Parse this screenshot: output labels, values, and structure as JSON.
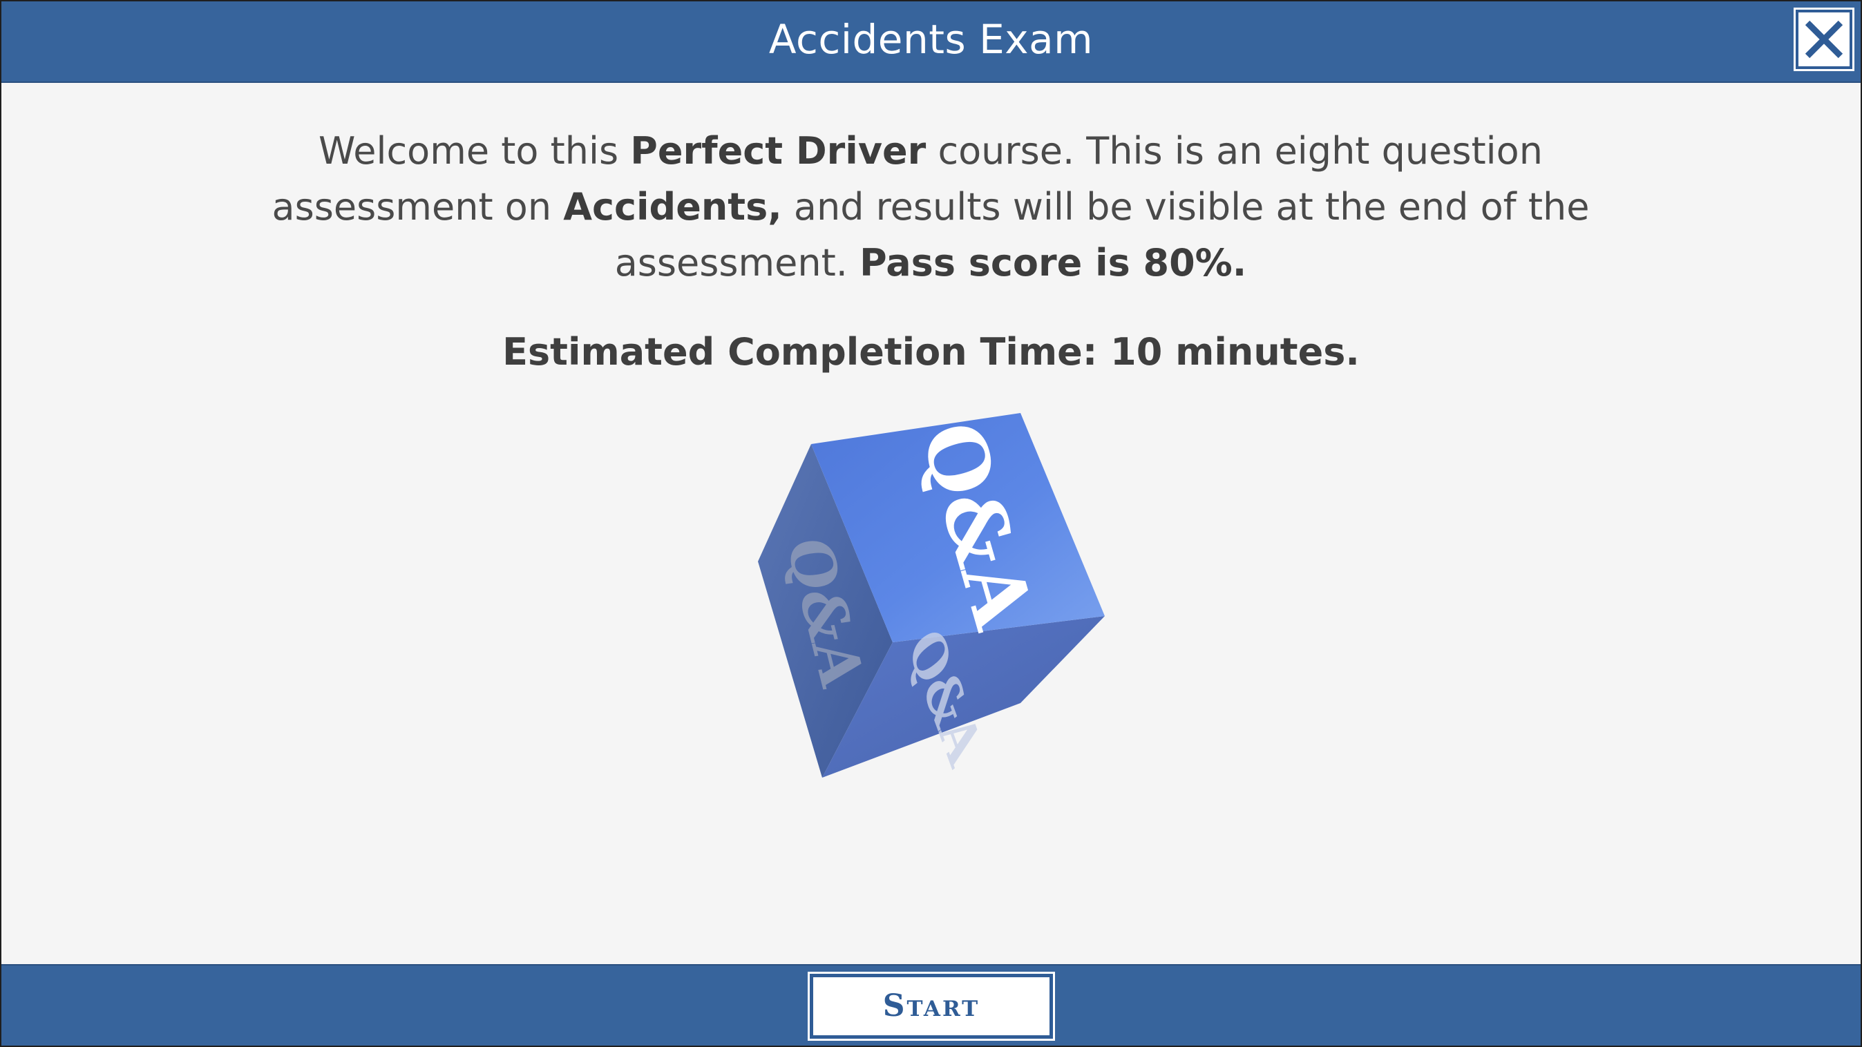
{
  "header": {
    "title": "Accidents Exam",
    "close_icon": "close-icon"
  },
  "intro": {
    "part1": "Welcome to this ",
    "course_name": "Perfect Driver",
    "part2": " course. This is an eight question assessment on ",
    "topic": "Accidents,",
    "part3": " and results will be visible at the end of the assessment. ",
    "pass_score": "Pass score is 80%."
  },
  "estimate": "Estimated Completion Time: 10 minutes.",
  "cube": {
    "icon": "qa-cube-icon",
    "face_label": "Q&A",
    "colors": {
      "top": "#4f77d8",
      "left": "#4a67a6",
      "right": "#5270c0"
    }
  },
  "footer": {
    "start_label": "Start"
  },
  "colors": {
    "bar": "#37649c",
    "background": "#f5f5f5",
    "text": "#4a4a4a"
  }
}
